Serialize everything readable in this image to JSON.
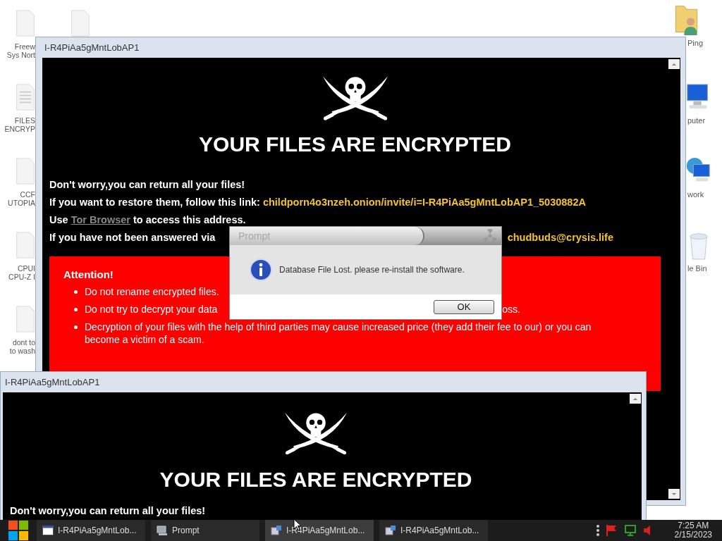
{
  "desktop": {
    "icons": [
      {
        "kind": "file",
        "lines": [
          "Freew",
          "Sys Nort"
        ]
      },
      {
        "kind": "document",
        "lines": [
          "FILES",
          "ENCRYP"
        ]
      },
      {
        "kind": "file",
        "lines": [
          "CCF",
          "UTOPIA"
        ]
      },
      {
        "kind": "file",
        "lines": [
          "CPUI",
          "CPU-Z I"
        ]
      },
      {
        "kind": "file",
        "lines": [
          "dont to",
          "to wash"
        ]
      },
      {
        "kind": "file"
      },
      {
        "kind": "user-folder",
        "lines": [
          "Ping"
        ]
      },
      {
        "kind": "computer",
        "lines": [
          "puter"
        ]
      },
      {
        "kind": "network",
        "lines": [
          "work"
        ]
      },
      {
        "kind": "recycle-bin",
        "lines": [
          "le Bin"
        ]
      }
    ]
  },
  "windows": [
    {
      "title": "I-R4PiAa5gMntLobAP1",
      "heading": "YOUR FILES ARE ENCRYPTED",
      "lines": [
        [
          [
            {
              "text": "Don't worry,you can return all your files!",
              "kind": "plain"
            }
          ]
        ],
        [
          [
            {
              "text": "If you want to restore them, follow this link: ",
              "kind": "plain"
            },
            {
              "text": "childporn4o3nzeh.onion/invite/i=I-R4PiAa5gMntLobAP1_5030882A",
              "kind": "highlight"
            }
          ]
        ],
        [
          [
            {
              "text": "Use ",
              "kind": "plain"
            },
            {
              "text": "Tor Browser",
              "kind": "link"
            },
            {
              "text": " to access this address.",
              "kind": "plain"
            }
          ]
        ],
        [
          [
            {
              "text": "If you have not been answered via",
              "kind": "plain"
            }
          ],
          [
            {
              "text": "chudbuds@crysis.life",
              "kind": "highlight"
            }
          ]
        ]
      ],
      "attention": {
        "title": "Attention!",
        "bullets": [
          [
            "Do not rename encrypted files."
          ],
          [
            "Do not try to decrypt your data",
            "oss."
          ],
          [
            "Decryption of your files with the help of third parties may cause increased price (they add their fee to our) or you can become a victim of a scam."
          ]
        ]
      }
    },
    {
      "title": "I-R4PiAa5gMntLobAP1",
      "heading": "YOUR FILES ARE ENCRYPTED",
      "lines": [
        [
          [
            {
              "text": "Don't worry,you can return all your files!",
              "kind": "plain"
            }
          ]
        ]
      ]
    }
  ],
  "dialog": {
    "title": "Prompt",
    "message": "Database File Lost. please re-install the software.",
    "button": "OK"
  },
  "taskbar": {
    "tasks": [
      {
        "label": "I-R4PiAa5gMntLob...",
        "kind": "window",
        "selected": false
      },
      {
        "label": "Prompt",
        "kind": "prompt",
        "selected": false
      },
      {
        "label": "I-R4PiAa5gMntLob...",
        "kind": "app",
        "selected": true
      },
      {
        "label": "I-R4PiAa5gMntLob...",
        "kind": "app",
        "selected": false
      }
    ],
    "clock": {
      "time": "7:25 AM",
      "date": "2/15/2023"
    }
  }
}
